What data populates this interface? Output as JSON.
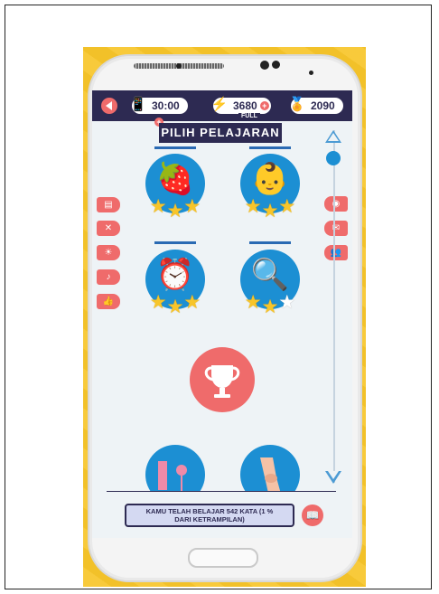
{
  "topbar": {
    "timer": "30:00",
    "energy": "3680",
    "energy_status": "FULL",
    "coins": "2090",
    "plus_symbol": "+"
  },
  "title": "PILIH PELAJARAN",
  "lessons": [
    {
      "name": "strawberry",
      "progress": 1.0,
      "stars": 3
    },
    {
      "name": "baby",
      "progress": 1.0,
      "stars": 3
    },
    {
      "name": "alarm-clock",
      "progress": 1.0,
      "stars": 3
    },
    {
      "name": "magnifier",
      "progress": 1.0,
      "stars": 2
    }
  ],
  "left_menu_icons": [
    "book-icon",
    "crossed-tools-icon",
    "sun-icon",
    "bell-icon",
    "thumbs-up-icon"
  ],
  "right_menu_icons": [
    "eye-icon",
    "envelope-icon",
    "people-icon"
  ],
  "bottom_lessons": [
    "flamingo",
    "knee"
  ],
  "info_text_line1": "KAMU TELAH BELAJAR 542 KATA (1 %",
  "info_text_line2": "DARI KETRAMPILAN)",
  "colors": {
    "accent": "#ef6b6b",
    "navy": "#2d2a52",
    "blue": "#1c8fd3",
    "star": "#f7c52a",
    "frame_yellow": "#f7c52a"
  }
}
